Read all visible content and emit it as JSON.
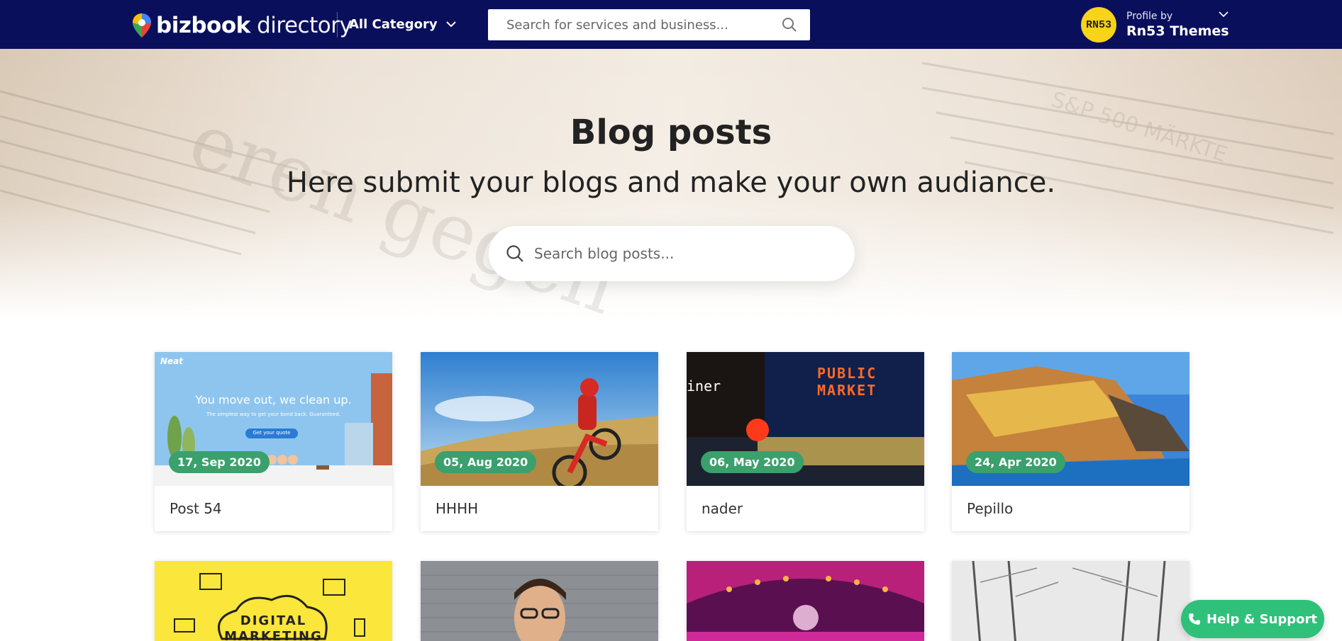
{
  "nav": {
    "logo_bold": "bizbook",
    "logo_light": " directory",
    "category_label": "All Category",
    "search_placeholder": "Search for services and business...",
    "profile_small": "Profile by",
    "profile_name": "Rn53 Themes",
    "avatar_text": "RN53"
  },
  "hero": {
    "title": "Blog posts",
    "subtitle": "Here submit your blogs and make your own audiance.",
    "search_placeholder": "Search blog posts..."
  },
  "posts": [
    {
      "date": "17, Sep 2020",
      "title": "Post 54",
      "image": "cleaning-service-banner"
    },
    {
      "date": "05, Aug 2020",
      "title": "HHHH",
      "image": "motocross-rider"
    },
    {
      "date": "06, May 2020",
      "title": "nader",
      "image": "public-market-neon"
    },
    {
      "date": "24, Apr 2020",
      "title": "Pepillo",
      "image": "coastal-village"
    }
  ],
  "posts_row2": [
    {
      "image": "digital-marketing"
    },
    {
      "image": "portrait-woman"
    },
    {
      "image": "concert-hall"
    },
    {
      "image": "snowy-forest"
    }
  ],
  "card1_banner": {
    "headline": "You move out, we clean up.",
    "sub": "The simplest way to get your bond back. Guaranteed.",
    "cta": "Get your quote",
    "brand": "Neat"
  },
  "card3_sign": {
    "line1": "PUBLIC",
    "line2": "MARKET",
    "side": "iner"
  },
  "card5_text": {
    "line1": "DIGITAL",
    "line2": "MARKETING"
  },
  "help": {
    "label": "Help & Support"
  },
  "colors": {
    "nav_bg": "#0a0f5c",
    "badge": "#3aa06c",
    "help": "#2fc07a",
    "avatar": "#f7d417"
  }
}
